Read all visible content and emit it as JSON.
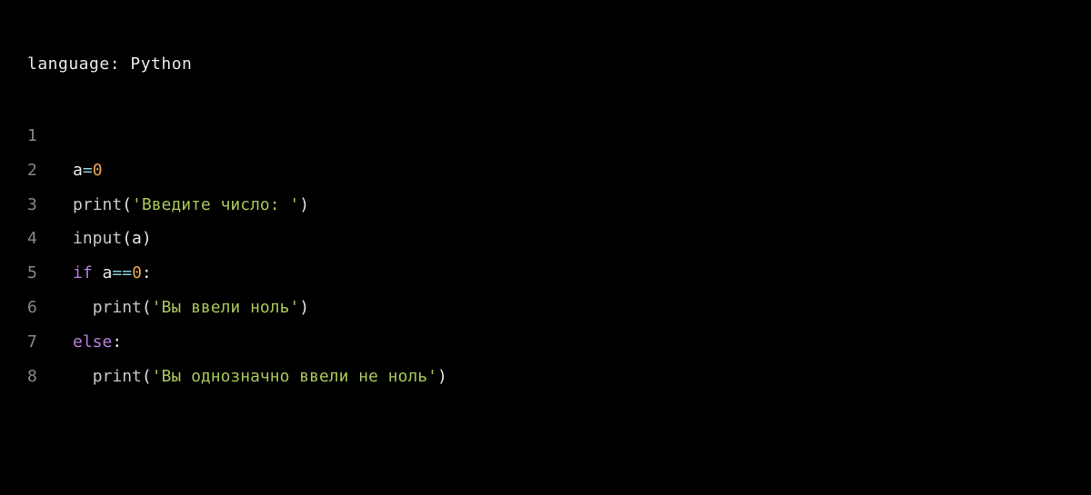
{
  "header": {
    "language_prefix": "language: ",
    "language_value": "Python"
  },
  "code": {
    "lines": [
      {
        "number": "1",
        "tokens": []
      },
      {
        "number": "2",
        "tokens": [
          {
            "cls": "tok-default",
            "text": "a"
          },
          {
            "cls": "tok-op",
            "text": "="
          },
          {
            "cls": "tok-number",
            "text": "0"
          }
        ]
      },
      {
        "number": "3",
        "tokens": [
          {
            "cls": "tok-func",
            "text": "print"
          },
          {
            "cls": "tok-paren",
            "text": "("
          },
          {
            "cls": "tok-string",
            "text": "'Введите число: '"
          },
          {
            "cls": "tok-paren",
            "text": ")"
          }
        ]
      },
      {
        "number": "4",
        "tokens": [
          {
            "cls": "tok-func",
            "text": "input"
          },
          {
            "cls": "tok-paren",
            "text": "("
          },
          {
            "cls": "tok-default",
            "text": "a"
          },
          {
            "cls": "tok-paren",
            "text": ")"
          }
        ]
      },
      {
        "number": "5",
        "tokens": [
          {
            "cls": "tok-keyword",
            "text": "if"
          },
          {
            "cls": "tok-default",
            "text": " a"
          },
          {
            "cls": "tok-op",
            "text": "=="
          },
          {
            "cls": "tok-number",
            "text": "0"
          },
          {
            "cls": "tok-default",
            "text": ":"
          }
        ]
      },
      {
        "number": "6",
        "tokens": [
          {
            "cls": "tok-default",
            "text": "  "
          },
          {
            "cls": "tok-func",
            "text": "print"
          },
          {
            "cls": "tok-paren",
            "text": "("
          },
          {
            "cls": "tok-string",
            "text": "'Вы ввели ноль'"
          },
          {
            "cls": "tok-paren",
            "text": ")"
          }
        ]
      },
      {
        "number": "7",
        "tokens": [
          {
            "cls": "tok-keyword",
            "text": "else"
          },
          {
            "cls": "tok-default",
            "text": ":"
          }
        ]
      },
      {
        "number": "8",
        "tokens": [
          {
            "cls": "tok-default",
            "text": "  "
          },
          {
            "cls": "tok-func",
            "text": "print"
          },
          {
            "cls": "tok-paren",
            "text": "("
          },
          {
            "cls": "tok-string",
            "text": "'Вы однозначно ввели не ноль'"
          },
          {
            "cls": "tok-paren",
            "text": ")"
          }
        ]
      }
    ]
  }
}
